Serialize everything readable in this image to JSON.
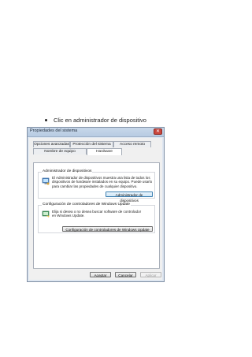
{
  "document": {
    "instruction": "Clic en administrador de dispositivo"
  },
  "dialog": {
    "title": "Propiedades del sistema",
    "close_glyph": "✕",
    "tabs": {
      "advanced": "Opciones avanzadas",
      "protection": "Protección del sistema",
      "remote": "Acceso remoto",
      "computer_name": "Nombre de equipo",
      "hardware": "Hardware"
    },
    "device_manager": {
      "title": "Administrador de dispositivos",
      "text": "El Administrador de dispositivos muestra una lista de todos los dispositivos de hardware instalados en su equipo. Puede usarlo para cambiar las propiedades de cualquier dispositivo.",
      "button": "Administrador de dispositivos"
    },
    "windows_update": {
      "title": "Configuración de controladores de Windows Update",
      "text": "Elija si desea o no desea buscar software de controlador en Windows Update.",
      "button": "Configuración de controladores de Windows Update"
    },
    "footer": {
      "ok": "Aceptar",
      "cancel": "Cancelar",
      "apply": "Aplicar"
    },
    "colors": {
      "accent": "#3c7fb1",
      "title_bar": "#c8d8ea",
      "close": "#c9463d"
    }
  }
}
